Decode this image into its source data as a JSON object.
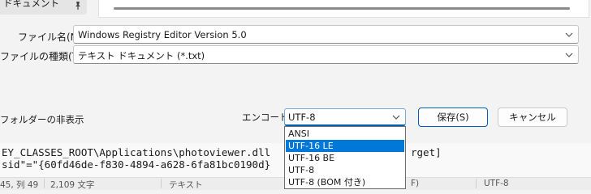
{
  "nav": {
    "documents_label": "ドキュメント"
  },
  "form": {
    "filename_label": "ファイル名(N):",
    "filename_value": "Windows Registry Editor Version 5.0",
    "filetype_label": "ファイルの種類(T):",
    "filetype_value": "テキスト ドキュメント (*.txt)"
  },
  "footer": {
    "hide_folders_label": "フォルダーの非表示",
    "encoding_label": "エンコード:",
    "encoding_value": "UTF-8",
    "save_label": "保存(S)",
    "cancel_label": "キャンセル"
  },
  "encoding_options": [
    {
      "label": "ANSI",
      "selected": false
    },
    {
      "label": "UTF-16 LE",
      "selected": true
    },
    {
      "label": "UTF-16 BE",
      "selected": false
    },
    {
      "label": "UTF-8",
      "selected": false
    },
    {
      "label": "UTF-8 (BOM 付き)",
      "selected": false
    }
  ],
  "editor": {
    "line1_start": "EY_CLASSES_ROOT\\Applications\\photoviewer.dll",
    "line1_end": "rget]",
    "line2": "sid\"=\"{60fd46de-f830-4894-a628-6fa81bc0190d}"
  },
  "status": {
    "position": "45, 列 49",
    "chars": "2,109 文字",
    "type": "テキスト",
    "line_ending": "F)",
    "encoding": "UTF-8"
  },
  "colors": {
    "accent": "#005fb8",
    "selection": "#0078d7"
  }
}
